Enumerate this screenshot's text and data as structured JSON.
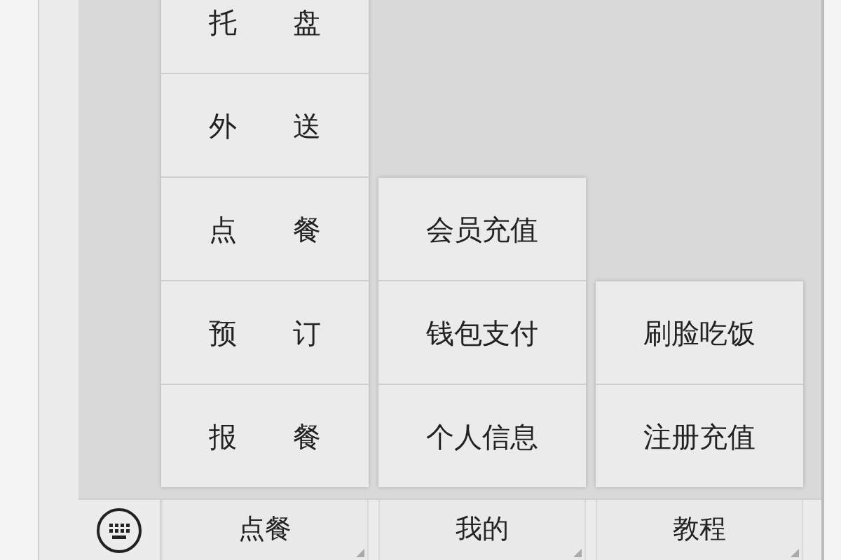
{
  "menus": [
    {
      "items": [
        "托　　盘",
        "外　　送",
        "点　　餐",
        "预　　订",
        "报　　餐"
      ]
    },
    {
      "items": [
        "会员充值",
        "钱包支付",
        "个人信息"
      ]
    },
    {
      "items": [
        "刷脸吃饭",
        "注册充值"
      ]
    }
  ],
  "bottom_bar": {
    "buttons": [
      "点餐",
      "我的",
      "教程"
    ]
  }
}
